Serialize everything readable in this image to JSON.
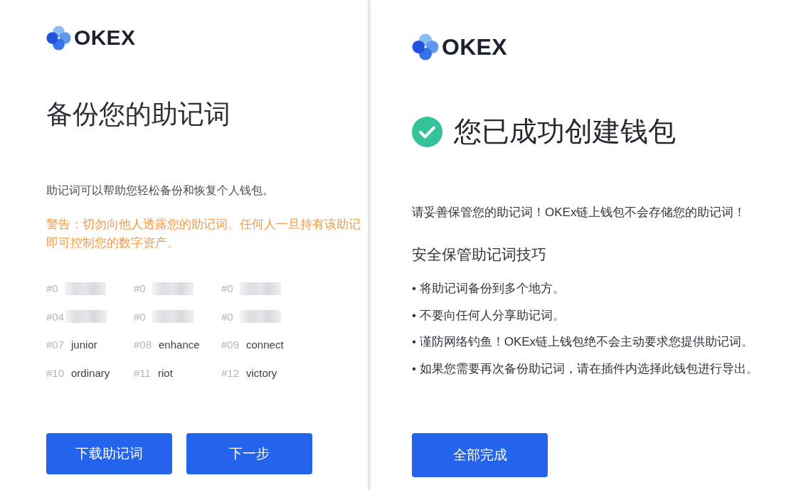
{
  "left_panel": {
    "logo": {
      "text": "OKEX"
    },
    "title": "备份您的助记词",
    "description": "助记词可以帮助您轻松备份和恢复个人钱包。",
    "warning_lines": [
      "警告：切勿向他人透露您的助记词。任何人一旦持有该助记",
      "即可控制您的数字资产。"
    ],
    "mnemonic_words": [
      {
        "index": "#0",
        "blurred": true
      },
      {
        "index": "#0",
        "blurred": true
      },
      {
        "index": "#0",
        "blurred": true
      },
      {
        "index": "#04",
        "blurred": true
      },
      {
        "index": "#0",
        "blurred": true
      },
      {
        "index": "#0",
        "blurred": true
      },
      {
        "index": "#07",
        "word": "junior",
        "blurred": false
      },
      {
        "index": "#08",
        "word": "enhance",
        "blurred": false
      },
      {
        "index": "#09",
        "word": "connect",
        "blurred": false
      },
      {
        "index": "#10",
        "word": "ordinary",
        "blurred": false
      },
      {
        "index": "#11",
        "word": "riot",
        "blurred": false
      },
      {
        "index": "#12",
        "word": "victory",
        "blurred": false
      }
    ],
    "buttons": [
      {
        "label": "下载助记词"
      },
      {
        "label": "下一步"
      }
    ]
  },
  "right_panel": {
    "logo": {
      "text": "OKEX"
    },
    "title": "您已成功创建钱包",
    "notice": "请妥善保管您的助记词！OKEx链上钱包不会存储您的助记词！",
    "tips_heading": "安全保管助记词技巧",
    "tips": [
      "• 将助记词备份到多个地方。",
      "• 不要向任何人分享助记词。",
      "• 谨防网络钓鱼！OKEx链上钱包绝不会主动要求您提供助记词。",
      "• 如果您需要再次备份助记词，请在插件内选择此钱包进行导出。"
    ],
    "button": {
      "label": "全部完成"
    }
  }
}
